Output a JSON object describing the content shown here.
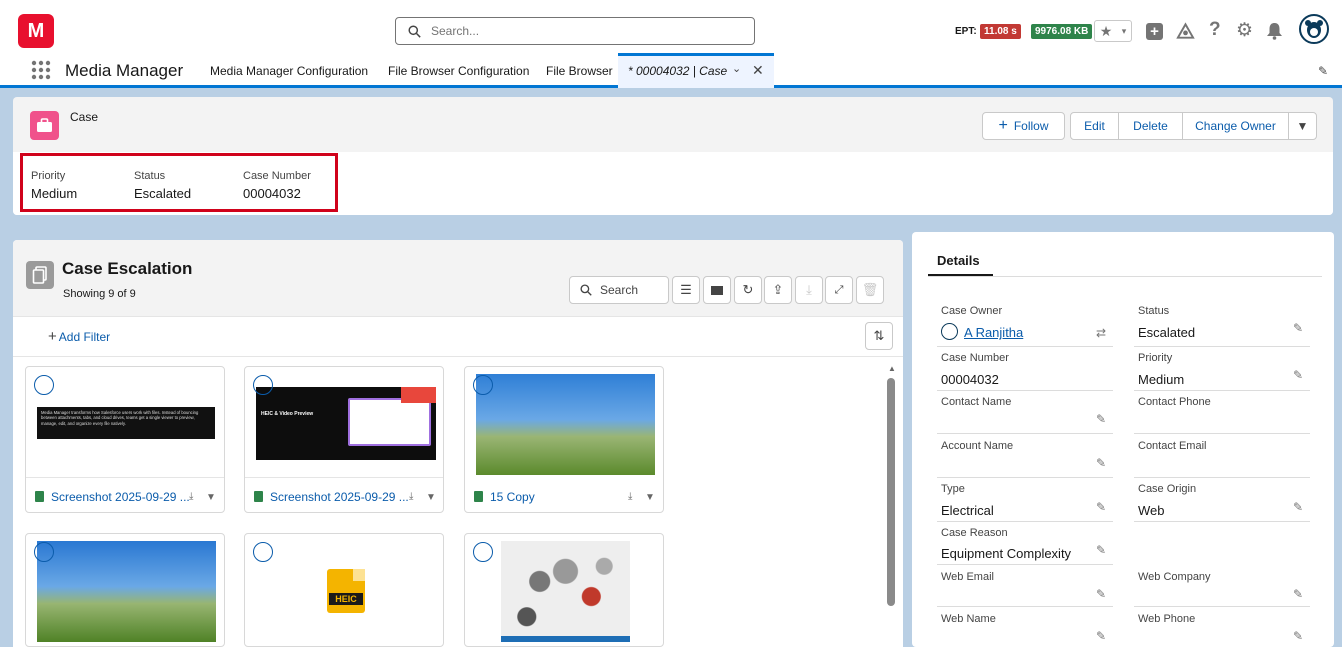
{
  "header": {
    "logo": "M",
    "search_placeholder": "Search...",
    "ept_label": "EPT:",
    "ept_value": "11.08 s",
    "memory_value": "9976.08 KB",
    "colors": {
      "ept": "#c23934",
      "memory": "#2e844a",
      "brand": "#e8102e"
    }
  },
  "nav": {
    "app_name": "Media Manager",
    "tabs": [
      "Media Manager Configuration",
      "File Browser Configuration",
      "File Browser"
    ],
    "active_tab": "* 00004032 | Case"
  },
  "record": {
    "object": "Case",
    "buttons": {
      "follow": "Follow",
      "edit": "Edit",
      "delete": "Delete",
      "change_owner": "Change Owner"
    },
    "fields": [
      {
        "label": "Priority",
        "value": "Medium"
      },
      {
        "label": "Status",
        "value": "Escalated"
      },
      {
        "label": "Case Number",
        "value": "00004032"
      }
    ]
  },
  "files": {
    "title": "Case Escalation",
    "count": "Showing 9 of 9",
    "search_placeholder": "Search",
    "add_filter": "Add Filter",
    "tiles": [
      {
        "name": "Screenshot 2025-09-29 ...",
        "thumb_text": "Media Manager transforms how Salesforce users work with files. Instead of bouncing between attachments, tabs, and cloud drives, teams get a single viewer to preview, manage, edit, and organize every file natively."
      },
      {
        "name": "Screenshot 2025-09-29 ...",
        "thumb_text": "HEIC & Video Preview"
      },
      {
        "name": "15 Copy",
        "thumb_text": ""
      },
      {
        "name": "",
        "thumb_text": ""
      },
      {
        "name": "",
        "thumb_text": "HEIC"
      },
      {
        "name": "",
        "thumb_text": ""
      }
    ]
  },
  "details": {
    "title": "Details",
    "fields": [
      {
        "label": "Case Owner",
        "value": "A Ranjitha"
      },
      {
        "label": "Status",
        "value": "Escalated"
      },
      {
        "label": "Case Number",
        "value": "00004032"
      },
      {
        "label": "Priority",
        "value": "Medium"
      },
      {
        "label": "Contact Name",
        "value": ""
      },
      {
        "label": "Contact Phone",
        "value": ""
      },
      {
        "label": "Account Name",
        "value": ""
      },
      {
        "label": "Contact Email",
        "value": ""
      },
      {
        "label": "Type",
        "value": "Electrical"
      },
      {
        "label": "Case Origin",
        "value": "Web"
      },
      {
        "label": "Case Reason",
        "value": "Equipment Complexity"
      },
      {
        "label": "Web Email",
        "value": ""
      },
      {
        "label": "Web Company",
        "value": ""
      },
      {
        "label": "Web Name",
        "value": ""
      },
      {
        "label": "Web Phone",
        "value": ""
      }
    ]
  }
}
